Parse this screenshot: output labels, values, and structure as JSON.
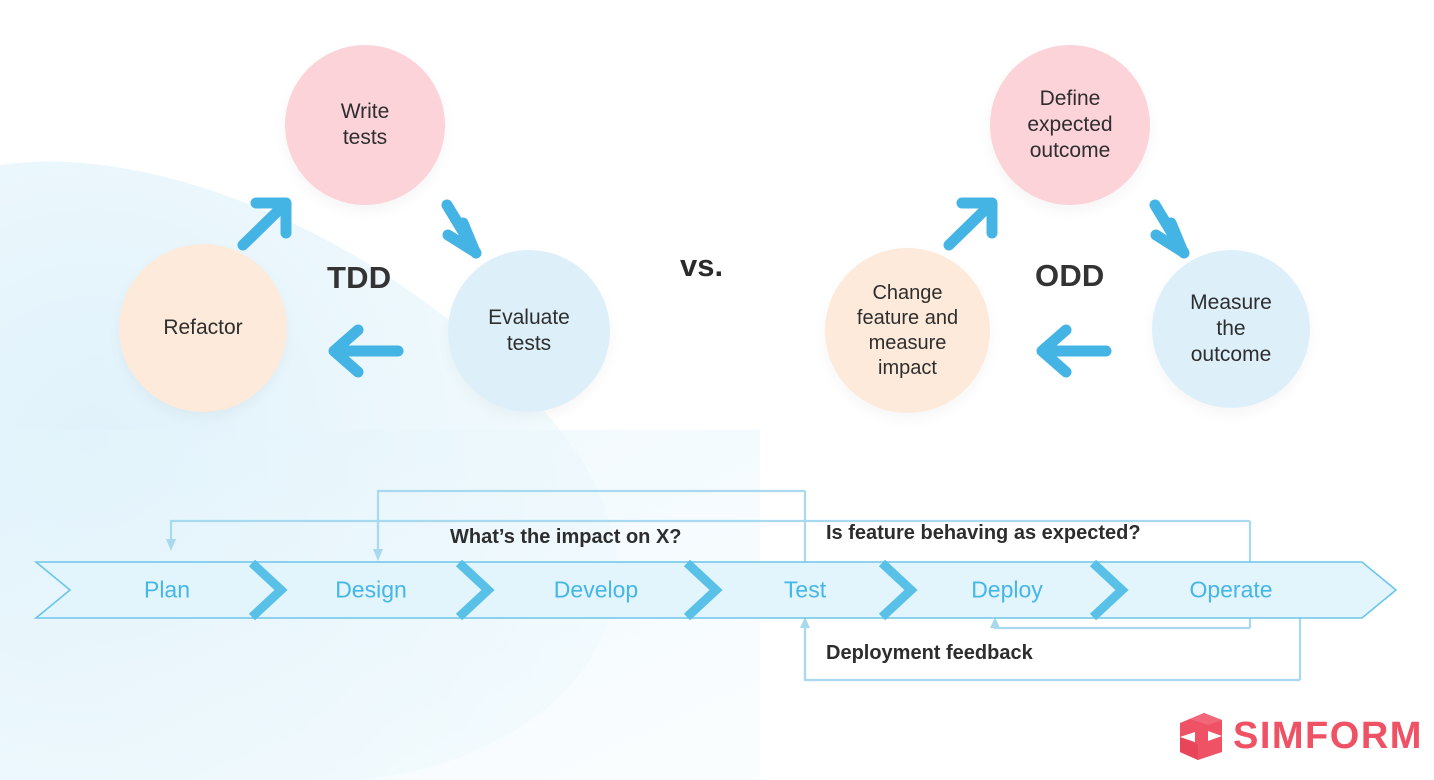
{
  "colors": {
    "pink": "#fbd3d9",
    "peach": "#fdeada",
    "lightblue": "#ddf0fa",
    "arrow_blue": "#44b4e4",
    "band_fill": "#e2f4fc",
    "band_stroke": "#6cc5e8",
    "chevron": "#59c0e8",
    "loop_line": "#a8d9ee",
    "stage_text": "#45b6e8",
    "dark_text": "#2d2d2d",
    "brand_red": "#ef5264",
    "blob": "#e8f6fc"
  },
  "cycles": [
    {
      "id": "tdd",
      "label": "TDD",
      "nodes": [
        {
          "name": "write-tests",
          "text": "Write\ntests",
          "color": "#fbd3d9"
        },
        {
          "name": "evaluate-tests",
          "text": "Evaluate\ntests",
          "color": "#ddf0fa"
        },
        {
          "name": "refactor",
          "text": "Refactor",
          "color": "#fdeada"
        }
      ],
      "arrows": [
        "arrow-up-right",
        "arrow-down-right",
        "arrow-left"
      ]
    },
    {
      "id": "odd",
      "label": "ODD",
      "nodes": [
        {
          "name": "define-expected-outcome",
          "text": "Define\nexpected\noutcome",
          "color": "#fbd3d9"
        },
        {
          "name": "measure-the-outcome",
          "text": "Measure\nthe\noutcome",
          "color": "#ddf0fa"
        },
        {
          "name": "change-feature-and-measure-impact",
          "text": "Change\nfeature and\nmeasure\nimpact",
          "color": "#fdeada"
        }
      ],
      "arrows": [
        "arrow-up-right",
        "arrow-down-right",
        "arrow-left"
      ]
    }
  ],
  "vs_label": "vs.",
  "pipeline": {
    "stages": [
      {
        "name": "plan",
        "label": "Plan"
      },
      {
        "name": "design",
        "label": "Design"
      },
      {
        "name": "develop",
        "label": "Develop"
      },
      {
        "name": "test",
        "label": "Test"
      },
      {
        "name": "deploy",
        "label": "Deploy"
      },
      {
        "name": "operate",
        "label": "Operate"
      }
    ],
    "loops": [
      {
        "name": "impact-loop",
        "label": "What’s the impact on X?"
      },
      {
        "name": "behaving-loop",
        "label": "Is feature behaving as expected?"
      },
      {
        "name": "deployment-feedback-loop",
        "label": "Deployment feedback"
      }
    ]
  },
  "logo": {
    "name": "simform-logo",
    "text": "SIMFORM"
  }
}
